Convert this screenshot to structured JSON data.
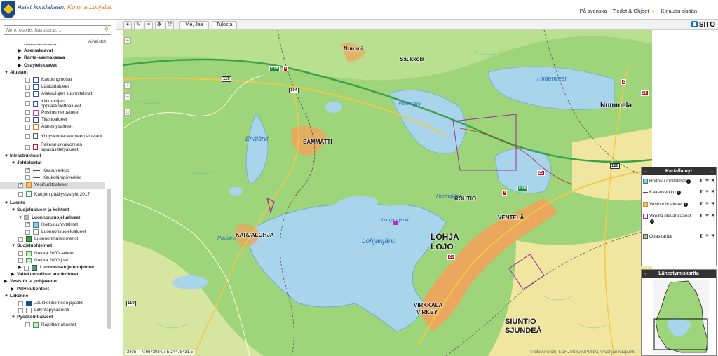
{
  "header": {
    "tagline_main": "Asiat kohdallaan.",
    "tagline_accent": "Kotona Lohjalla.",
    "nav": {
      "swedish": "På svenska",
      "info": "Tiedot & Ohjeet",
      "login": "Kirjaudu sisään"
    }
  },
  "sidebar": {
    "search_placeholder": "Nimi, osoite, hakusana, ...",
    "section_title": "Aineistot",
    "tree": [
      {
        "label": "Kaavoitusalueet",
        "level": 2,
        "arrow": "",
        "bold": false
      },
      {
        "label": "Asemakaavat",
        "level": 2,
        "arrow": "▶",
        "bold": true
      },
      {
        "label": "Ranta-asemakaava",
        "level": 2,
        "arrow": "▶",
        "bold": true
      },
      {
        "label": "Osayleiskaavat",
        "level": 2,
        "arrow": "▶",
        "bold": true
      },
      {
        "label": "Aluejaot",
        "level": 0,
        "arrow": "▼",
        "bold": true
      },
      {
        "label": "Kaupunginosat",
        "level": 3,
        "cb": "",
        "sw": "#ffffff",
        "swb": "#2b4fbf"
      },
      {
        "label": "Lääkärialueet",
        "level": 3,
        "cb": "",
        "sw": "#ffffff",
        "swb": "#2b4fbf"
      },
      {
        "label": "Alakoulujen suunnitelmat",
        "level": 3,
        "cb": "",
        "sw": "#ffffff",
        "swb": "#2b4fbf"
      },
      {
        "label": "Yläkoulujen oppilaaksiottoalueet",
        "level": 3,
        "cb": "",
        "sw": "#ffffff",
        "swb": "#2b4fbf"
      },
      {
        "label": "Postinumeroalueet",
        "level": 3,
        "cb": "",
        "sw": "#ffffff",
        "swb": "#d13fa0"
      },
      {
        "label": "Tilastoalueet",
        "level": 3,
        "cb": "",
        "sw": "#ffffff",
        "swb": "#2b4fbf"
      },
      {
        "label": "Äänestysalueet",
        "level": 3,
        "cb": "",
        "sw": "#ffffff",
        "swb": "#e07a1a"
      },
      {
        "label": "Yhdyskuntarakenteen aluejaot",
        "level": 3,
        "cb": "",
        "sw": "#ffffff",
        "swb": "#555555"
      },
      {
        "label": "Rakennusvalvonnan lupakäsittelyalueet",
        "level": 3,
        "cb": "",
        "sw": "#ffffff",
        "swb": "#c0202a"
      },
      {
        "label": "Infrastruktuuri",
        "level": 0,
        "arrow": "▼",
        "bold": true
      },
      {
        "label": "Johtokartat",
        "level": 1,
        "arrow": "▼",
        "bold": true
      },
      {
        "label": "Kaasuverkko",
        "level": 3,
        "cb": "checked",
        "line": "#c0202a"
      },
      {
        "label": "Kaukolämpöverkko",
        "level": 3,
        "cb": "",
        "line": "#2b4fbf"
      },
      {
        "label": "Vesihuoltoalueet",
        "level": 2,
        "cb": "checked",
        "sw": "#f5c26b",
        "swb": "#c98a2a",
        "sel": true
      },
      {
        "label": "Katujen päällystystyöt 2017",
        "level": 2,
        "cb": "",
        "sw": "#ffffff",
        "swb": "#3a9e5a"
      },
      {
        "label": "Luonto",
        "level": 0,
        "arrow": "▼",
        "bold": true
      },
      {
        "label": "Suojelualueet ja kohteet",
        "level": 1,
        "arrow": "▼",
        "bold": true
      },
      {
        "label": "Luonnonsuojelualueet",
        "level": 2,
        "arrow": "▼",
        "bold": true,
        "cb": "partial"
      },
      {
        "label": "Hoitosuunnitelmat",
        "level": 3,
        "cb": "checked",
        "sw": "#8ad0e0",
        "swb": "#3a7aa0"
      },
      {
        "label": "Luonnonsuojelualueet",
        "level": 3,
        "cb": "",
        "sw": "#ffffff",
        "swb": "#888888"
      },
      {
        "label": "Luonnonmuistomerkit",
        "level": 2,
        "cb": "",
        "sw": "#3aa34a",
        "swb": "#1d6a2a"
      },
      {
        "label": "Suojeluohjelmat",
        "level": 1,
        "arrow": "▼",
        "bold": true
      },
      {
        "label": "Natura 2000 -alueet",
        "level": 2,
        "cb": "",
        "sw": "#cfe8c6",
        "swb": "#3aa34a"
      },
      {
        "label": "Natura 2000 joet",
        "level": 2,
        "cb": "",
        "sw": "#cfe8c6",
        "swb": "#3aa34a"
      },
      {
        "label": "Luonnonsuojeluohjelmat",
        "level": 2,
        "arrow": "▶",
        "bold": true,
        "cb": "",
        "sw": "#5a9a7a",
        "swb": "#2a5a4a"
      },
      {
        "label": "Valtakunnalliset arvokohteet",
        "level": 1,
        "arrow": "▶",
        "bold": true
      },
      {
        "label": "Vesistöt ja pohjavedet",
        "level": 0,
        "arrow": "▶",
        "bold": true
      },
      {
        "label": "Palvelukohteet",
        "level": 1,
        "arrow": "▶",
        "bold": true
      },
      {
        "label": "Liikenne",
        "level": 0,
        "arrow": "▼",
        "bold": true
      },
      {
        "label": "Joukkoliikenteen pysäkit",
        "level": 2,
        "cb": "",
        "sw": "#1a4a8a",
        "swb": "#1a4a8a"
      },
      {
        "label": "Liityntäpysäköinti",
        "level": 2,
        "cb": "",
        "sw": "#ffffff",
        "swb": "#888888"
      },
      {
        "label": "Pysäköintialueet",
        "level": 1,
        "arrow": "▼",
        "bold": true
      },
      {
        "label": "Rajoittamattomat",
        "level": 3,
        "cb": "",
        "sw": "#cfe8c6",
        "swb": "#3aa34a"
      }
    ]
  },
  "toolbar": {
    "vie_jaa": "Vie, Jaa",
    "tulosta": "Tulosta",
    "brand": "SITO"
  },
  "map": {
    "places": [
      {
        "name": "Nummi"
      },
      {
        "name": "Saukkola"
      },
      {
        "name": "Nummela"
      },
      {
        "name": "SAMMATTI"
      },
      {
        "name": "KARJALOHJA"
      },
      {
        "name": "ROUTIO"
      },
      {
        "name": "VENTELÄ"
      },
      {
        "name": "LOHJA"
      },
      {
        "name": "LOJO"
      },
      {
        "name": "VIRKKALA"
      },
      {
        "name": "VIRKBY"
      },
      {
        "name": "SIUNTIO"
      },
      {
        "name": "SJUNDEÅ"
      }
    ],
    "lakes": [
      {
        "name": "Hiidenvesi"
      },
      {
        "name": "Lohjanjärvi"
      },
      {
        "name": "Enäjärvi"
      },
      {
        "name": "Valkerpyy"
      },
      {
        "name": "Hormajärvi"
      },
      {
        "name": "Puujärvi"
      },
      {
        "name": "Lohjan järvi"
      }
    ],
    "roads": [
      {
        "label": "E18",
        "kind": "green"
      },
      {
        "label": "1",
        "kind": "red"
      },
      {
        "label": "2",
        "kind": "red"
      },
      {
        "label": "25",
        "kind": "red"
      },
      {
        "label": "25",
        "kind": "red"
      },
      {
        "label": "E18",
        "kind": "green"
      },
      {
        "label": "1",
        "kind": "red"
      },
      {
        "label": "25",
        "kind": "red"
      },
      {
        "label": "110",
        "kind": "white"
      },
      {
        "label": "104",
        "kind": "white"
      },
      {
        "label": "110",
        "kind": "white"
      },
      {
        "label": "186",
        "kind": "white"
      }
    ],
    "scale": "2 km",
    "coords": "N:6673034,7 E:24478431,5",
    "copyright": "©Sito Aineisto: LOHJAN KAUPUNKI, © Lohjan kaupunki"
  },
  "karttalla": {
    "title": "Kartalla nyt",
    "layers": [
      {
        "label": "Hoitosuunnitelmat",
        "sw": "#8ad0e0",
        "swb": "#3a7aa0",
        "info": "i"
      },
      {
        "label": "Kaasuverkko",
        "sw": "line",
        "swb": "#c0202a",
        "info": "i"
      },
      {
        "label": "Vesihuoltoalueet",
        "sw": "#f5c26b",
        "swb": "#c98a2a",
        "info": "i"
      },
      {
        "label": "Vireillä olevat kaavat",
        "sw": "#ffffff",
        "swb": "#a02a9a",
        "info": "i"
      },
      {
        "label": "Opaskartta",
        "sw": "map",
        "swb": "#555555",
        "info": ""
      }
    ]
  },
  "lahestymis": {
    "title": "Lähestymiskartta"
  },
  "colors": {
    "accent": "#e07a1a",
    "brand_blue": "#1a4a8a",
    "water": "#a8d4ec",
    "land_green": "#9ed47a",
    "urban": "#f2a25a"
  },
  "icons": {
    "search": "search-icon",
    "zoom_in": "plus-icon",
    "zoom_out": "minus-icon"
  }
}
